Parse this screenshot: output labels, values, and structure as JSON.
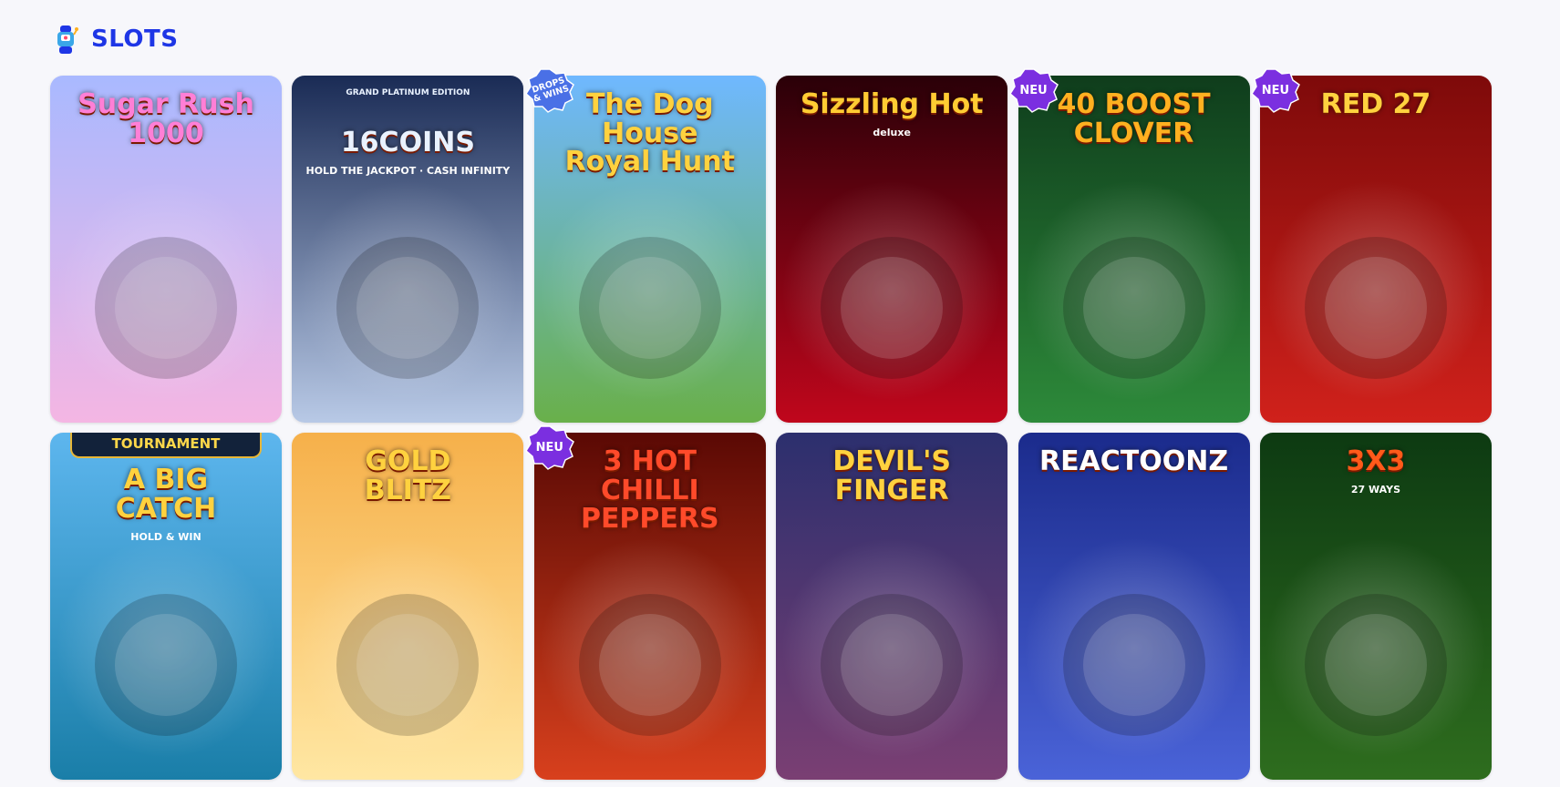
{
  "section": {
    "title": "SLOTS",
    "icon": "slot-machine-icon"
  },
  "badges": {
    "new": "NEU",
    "drops_line1": "DROPS",
    "drops_line2": "& WINS"
  },
  "games": [
    {
      "title": "Sugar Rush\n1000",
      "sub": "",
      "badge": "",
      "colors": [
        "#a9b9ff",
        "#f4b6e3"
      ],
      "title_color": "#ff7fd6"
    },
    {
      "title": "16COINS",
      "sub": "HOLD THE JACKPOT · CASH INFINITY",
      "top_sub": "GRAND PLATINUM EDITION",
      "badge": "",
      "colors": [
        "#1a2b55",
        "#b8c9e6"
      ],
      "title_color": "#e9f2ff"
    },
    {
      "title": "The Dog House\nRoyal Hunt",
      "sub": "",
      "badge": "drops",
      "colors": [
        "#6fb8ff",
        "#69b04a"
      ],
      "title_color": "#ffd23f"
    },
    {
      "title": "Sizzling Hot",
      "sub": "deluxe",
      "badge": "",
      "colors": [
        "#2a0008",
        "#c0061c"
      ],
      "title_color": "#ffcc33"
    },
    {
      "title": "40 BOOST CLOVER",
      "sub": "",
      "badge": "new",
      "colors": [
        "#0f3d1c",
        "#2d8a3a"
      ],
      "title_color": "#ffb020"
    },
    {
      "title": "RED 27",
      "sub": "",
      "badge": "new",
      "colors": [
        "#7e0a0a",
        "#d0211b"
      ],
      "title_color": "#ffd23f"
    },
    {
      "title": "A BIG\nCATCH",
      "sub": "HOLD & WIN",
      "tournament": "TOURNAMENT",
      "badge": "",
      "colors": [
        "#5db6ee",
        "#1a7ea8"
      ],
      "title_color": "#ffd23f"
    },
    {
      "title": "GOLD\nBLITZ",
      "sub": "",
      "badge": "",
      "colors": [
        "#f6b04a",
        "#ffe7a3"
      ],
      "title_color": "#ffd23f"
    },
    {
      "title": "3 HOT\nCHILLI\nPEPPERS",
      "sub": "",
      "badge": "new",
      "colors": [
        "#5a0904",
        "#d8401d"
      ],
      "title_color": "#ff4a2a"
    },
    {
      "title": "DEVIL'S\nFINGER",
      "sub": "",
      "badge": "",
      "colors": [
        "#2c2f6e",
        "#7a3f73"
      ],
      "title_color": "#ffd23f"
    },
    {
      "title": "REACTOONZ",
      "sub": "",
      "badge": "",
      "colors": [
        "#1b2b8c",
        "#4a63d8"
      ],
      "title_color": "#ffffff"
    },
    {
      "title": "3X3",
      "sub": "27 WAYS",
      "badge": "",
      "colors": [
        "#0d3a12",
        "#2e6d1e"
      ],
      "title_color": "#ff5a1a"
    }
  ]
}
